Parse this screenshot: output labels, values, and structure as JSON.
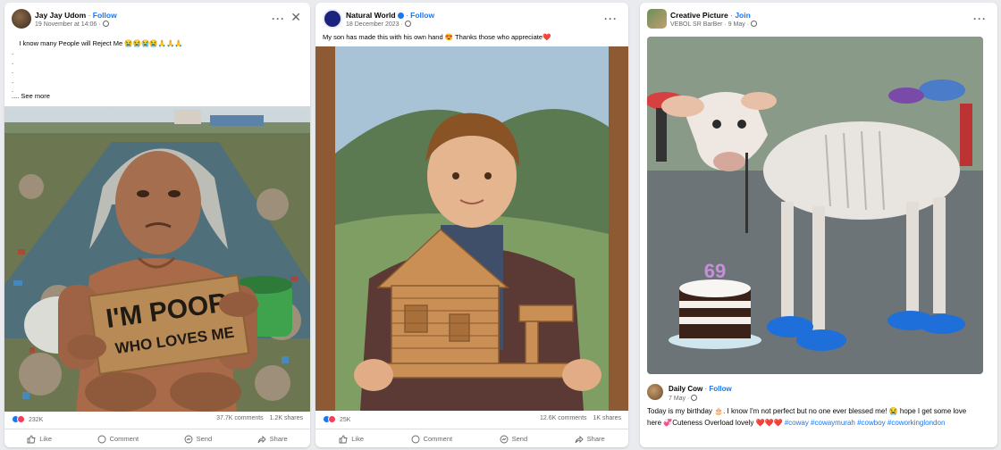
{
  "posts": [
    {
      "author": "Jay Jay Udom",
      "follow": "Follow",
      "date": "19 November at 14:06 ·",
      "caption": "I know many People will Reject Me 😭😭😭😭🙏🙏🙏\n.\n.\n.\n.\n.",
      "see_more": ".... See more",
      "sign_text_1": "I'M POOR",
      "sign_text_2": "WHO LOVES ME",
      "reactions": "232K",
      "comments": "37.7K comments",
      "shares": "1.2K shares",
      "actions": [
        "Like",
        "Comment",
        "Send",
        "Share"
      ]
    },
    {
      "author": "Natural World",
      "follow": "Follow",
      "date": "18 December 2023 ·",
      "caption": "My son has made this with his own hand 😍 Thanks those who appreciate❤️",
      "reactions": "25K",
      "comments": "12.6K comments",
      "shares": "1K shares",
      "actions": [
        "Like",
        "Comment",
        "Send",
        "Share"
      ]
    },
    {
      "group": "Creative Picture",
      "join": "Join",
      "author_sub": "VEBOL SR BarBer · 9 May ·",
      "cake_topper": "69",
      "embedded": {
        "author": "Daily Cow",
        "follow": "Follow",
        "date": "7 May ·",
        "text_plain": "Today is my birthday 🎂. I know I'm not perfect but no one ever blessed me! 😭 hope I get some love here 💞Cuteness Overload lovely ❤️❤️❤️ ",
        "hashtags": [
          "#coway",
          "#cowaymurah",
          "#cowboy",
          "#coworkinglondon"
        ]
      }
    }
  ],
  "colors": {
    "accent": "#1877f2",
    "background": "#e9ebee"
  }
}
